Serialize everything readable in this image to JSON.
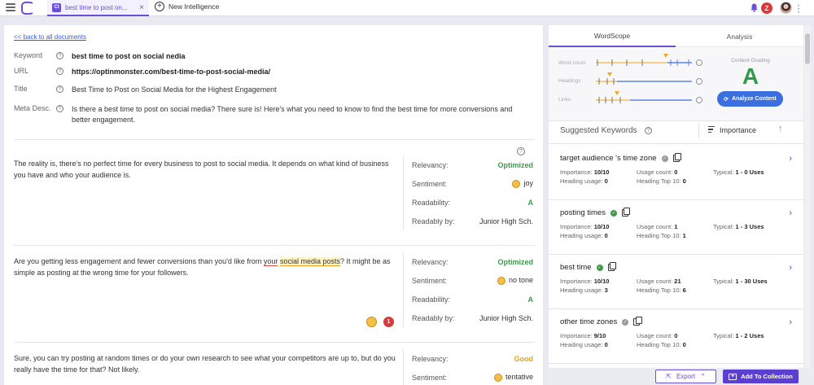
{
  "topbar": {
    "active_tab": "best time to post on...",
    "tab_icon_letter": "CI",
    "new_tab_label": "New Intelligence",
    "avatar_letter": "Z"
  },
  "document": {
    "back_link": "<< back to all documents",
    "keyword_label": "Keyword",
    "keyword": "best time to post on social nedia",
    "url_label": "URL",
    "url": "https://optinmonster.com/best-time-to-post-social-media/",
    "title_label": "Title",
    "title": "Best Time to Post on Social Media for the Highest Engagement",
    "meta_label": "Meta Desc.",
    "meta": "Is there a best time to post on social media? There sure is! Here's what you need to know to find the best time for more conversions and better engagement."
  },
  "metric_labels": {
    "relevancy": "Relevancy:",
    "sentiment": "Sentiment:",
    "readability": "Readability:",
    "readably_by": "Readably by:"
  },
  "paragraphs": [
    {
      "text": "The reality is, there's no perfect time for every business to post to social media. It depends on what kind of business you have and who your audience is.",
      "relevancy": "Optimized",
      "sentiment": "joy",
      "readability": "A",
      "readably_by": "Junior High Sch."
    },
    {
      "text_a": "Are you getting less engagement and fewer conversions than you'd like from ",
      "text_ul": "your",
      "text_hl": "social media posts",
      "text_b": "? It might be as simple as posting at the wrong time for your followers.",
      "relevancy": "Optimized",
      "sentiment": "no tone",
      "readability": "A",
      "readably_by": "Junior High Sch.",
      "badge_count": "1"
    },
    {
      "text": "Sure, you can try posting at random times or do your own research to see what your competitors are up to, but do you really have the time for that? Not likely.",
      "relevancy": "Good",
      "sentiment": "tentative"
    }
  ],
  "sidebar": {
    "tabs": [
      "WordScope",
      "Analysis"
    ],
    "scope_labels": [
      "Word count",
      "Headings",
      "Links"
    ],
    "grading_title": "Content Grading",
    "grade": "A",
    "analyze_button": "Analyze Content",
    "suggested_title": "Suggested Keywords",
    "sort_label": "Importance",
    "stat_labels": {
      "importance": "Importance:",
      "usage": "Usage count:",
      "typical": "Typical:",
      "heading_usage": "Heading usage:",
      "heading_top": "Heading Top 10:"
    },
    "keywords": [
      {
        "name": "target audience 's time zone",
        "importance": "10/10",
        "usage": "0",
        "typical": "1 - 0 Uses",
        "heading_usage": "0",
        "heading_top": "0"
      },
      {
        "name": "posting times",
        "importance": "10/10",
        "usage": "1",
        "typical": "1 - 3 Uses",
        "heading_usage": "0",
        "heading_top": "1"
      },
      {
        "name": "best time",
        "importance": "10/10",
        "usage": "21",
        "typical": "1 - 30 Uses",
        "heading_usage": "3",
        "heading_top": "6"
      },
      {
        "name": "other time zones",
        "importance": "9/10",
        "usage": "0",
        "typical": "1 - 2 Uses",
        "heading_usage": "0",
        "heading_top": "0"
      }
    ]
  },
  "footer": {
    "export": "Export",
    "add": "Add To Collection"
  },
  "colors": {
    "accent": "#6b4fd8",
    "good": "#3c9a4a",
    "warn": "#e7a21b",
    "blue": "#3b6fe0"
  }
}
